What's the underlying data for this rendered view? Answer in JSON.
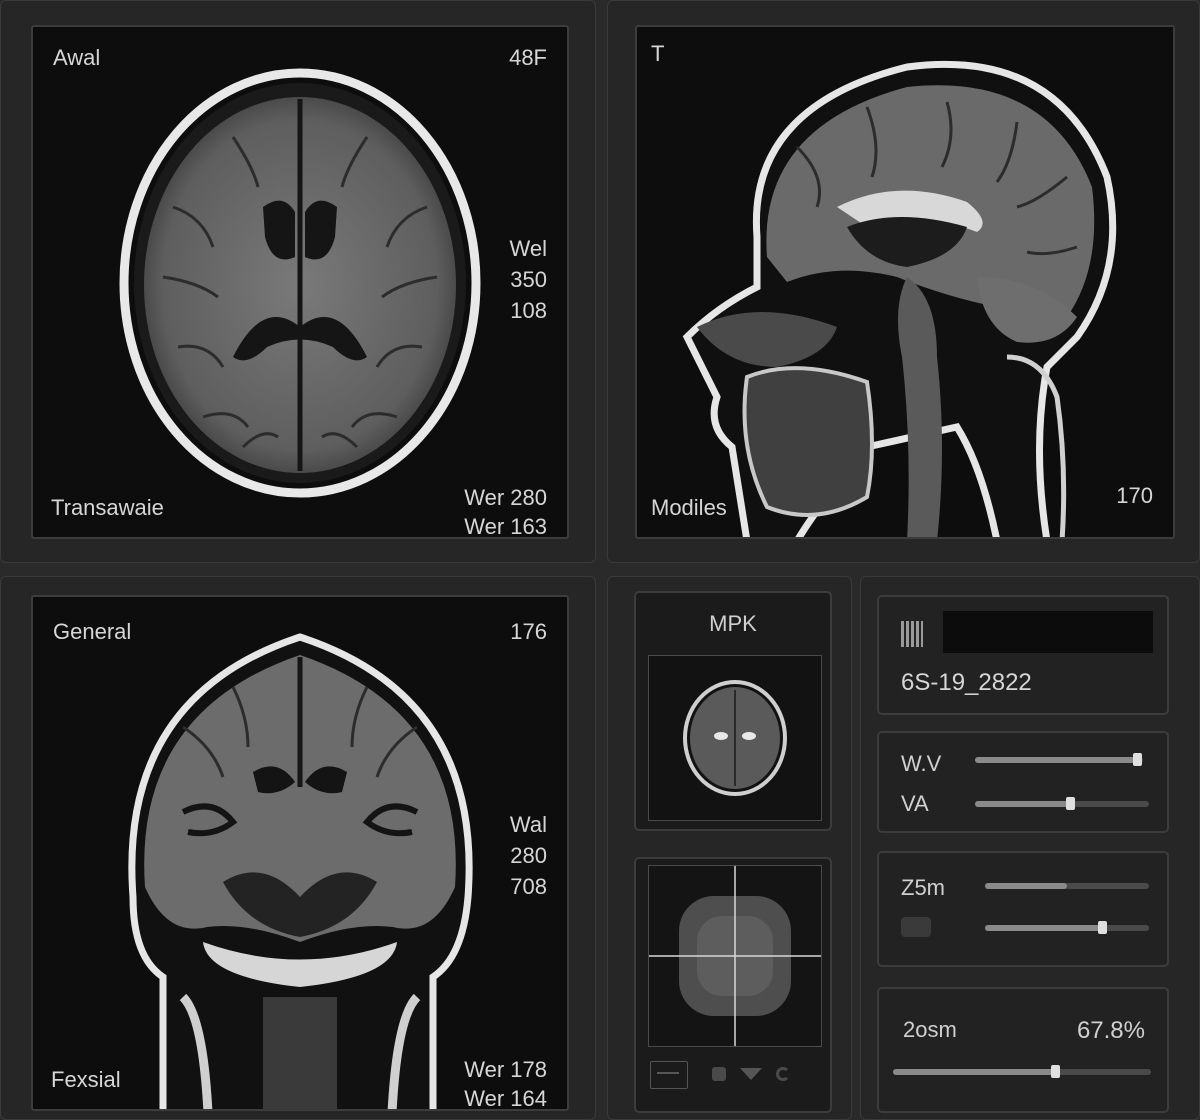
{
  "viewports": {
    "axial": {
      "top_left": "Awal",
      "top_right": "48F",
      "right_stack": [
        "Wel",
        "350",
        "108"
      ],
      "bottom_left": "Transawaie",
      "bottom_right": [
        "Wer 280",
        "Wer 163"
      ]
    },
    "sagittal": {
      "top_left": "T",
      "bottom_left": "Modiles",
      "bottom_right": "170"
    },
    "coronal": {
      "top_left": "General",
      "top_right": "176",
      "right_stack": [
        "Wal",
        "280",
        "708"
      ],
      "bottom_left": "Fexsial",
      "bottom_right": [
        "Wer 178",
        "Wer 164"
      ]
    }
  },
  "mpr": {
    "title": "MPK"
  },
  "info_panel": {
    "study_id": "6S-19_2822"
  },
  "window_panel": {
    "wv_label": "W.V",
    "va_label": "VA",
    "wv_value": 0.97,
    "va_value": 0.55
  },
  "zoom_sliders": {
    "label": "Z5m",
    "slider1_value": 0.5,
    "slider2_value": 0.72
  },
  "zoom_panel": {
    "label": "2osm",
    "value": "67.8%",
    "slider_value": 0.63
  },
  "icons": [
    "document-icon",
    "flip-icon",
    "down-arrow-icon",
    "rotate-icon"
  ]
}
